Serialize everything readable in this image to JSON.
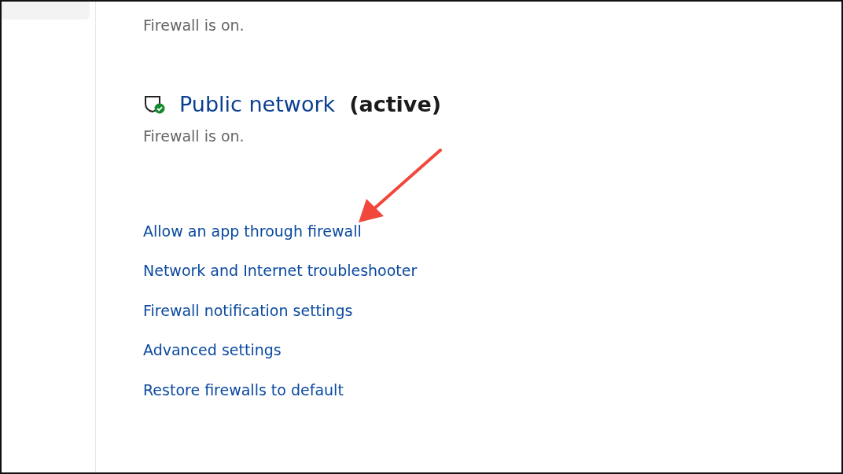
{
  "private_status": "Firewall is on.",
  "public_network": {
    "title": "Public network",
    "state": "(active)",
    "status": "Firewall is on."
  },
  "links": [
    "Allow an app through firewall",
    "Network and Internet troubleshooter",
    "Firewall notification settings",
    "Advanced settings",
    "Restore firewalls to default"
  ]
}
